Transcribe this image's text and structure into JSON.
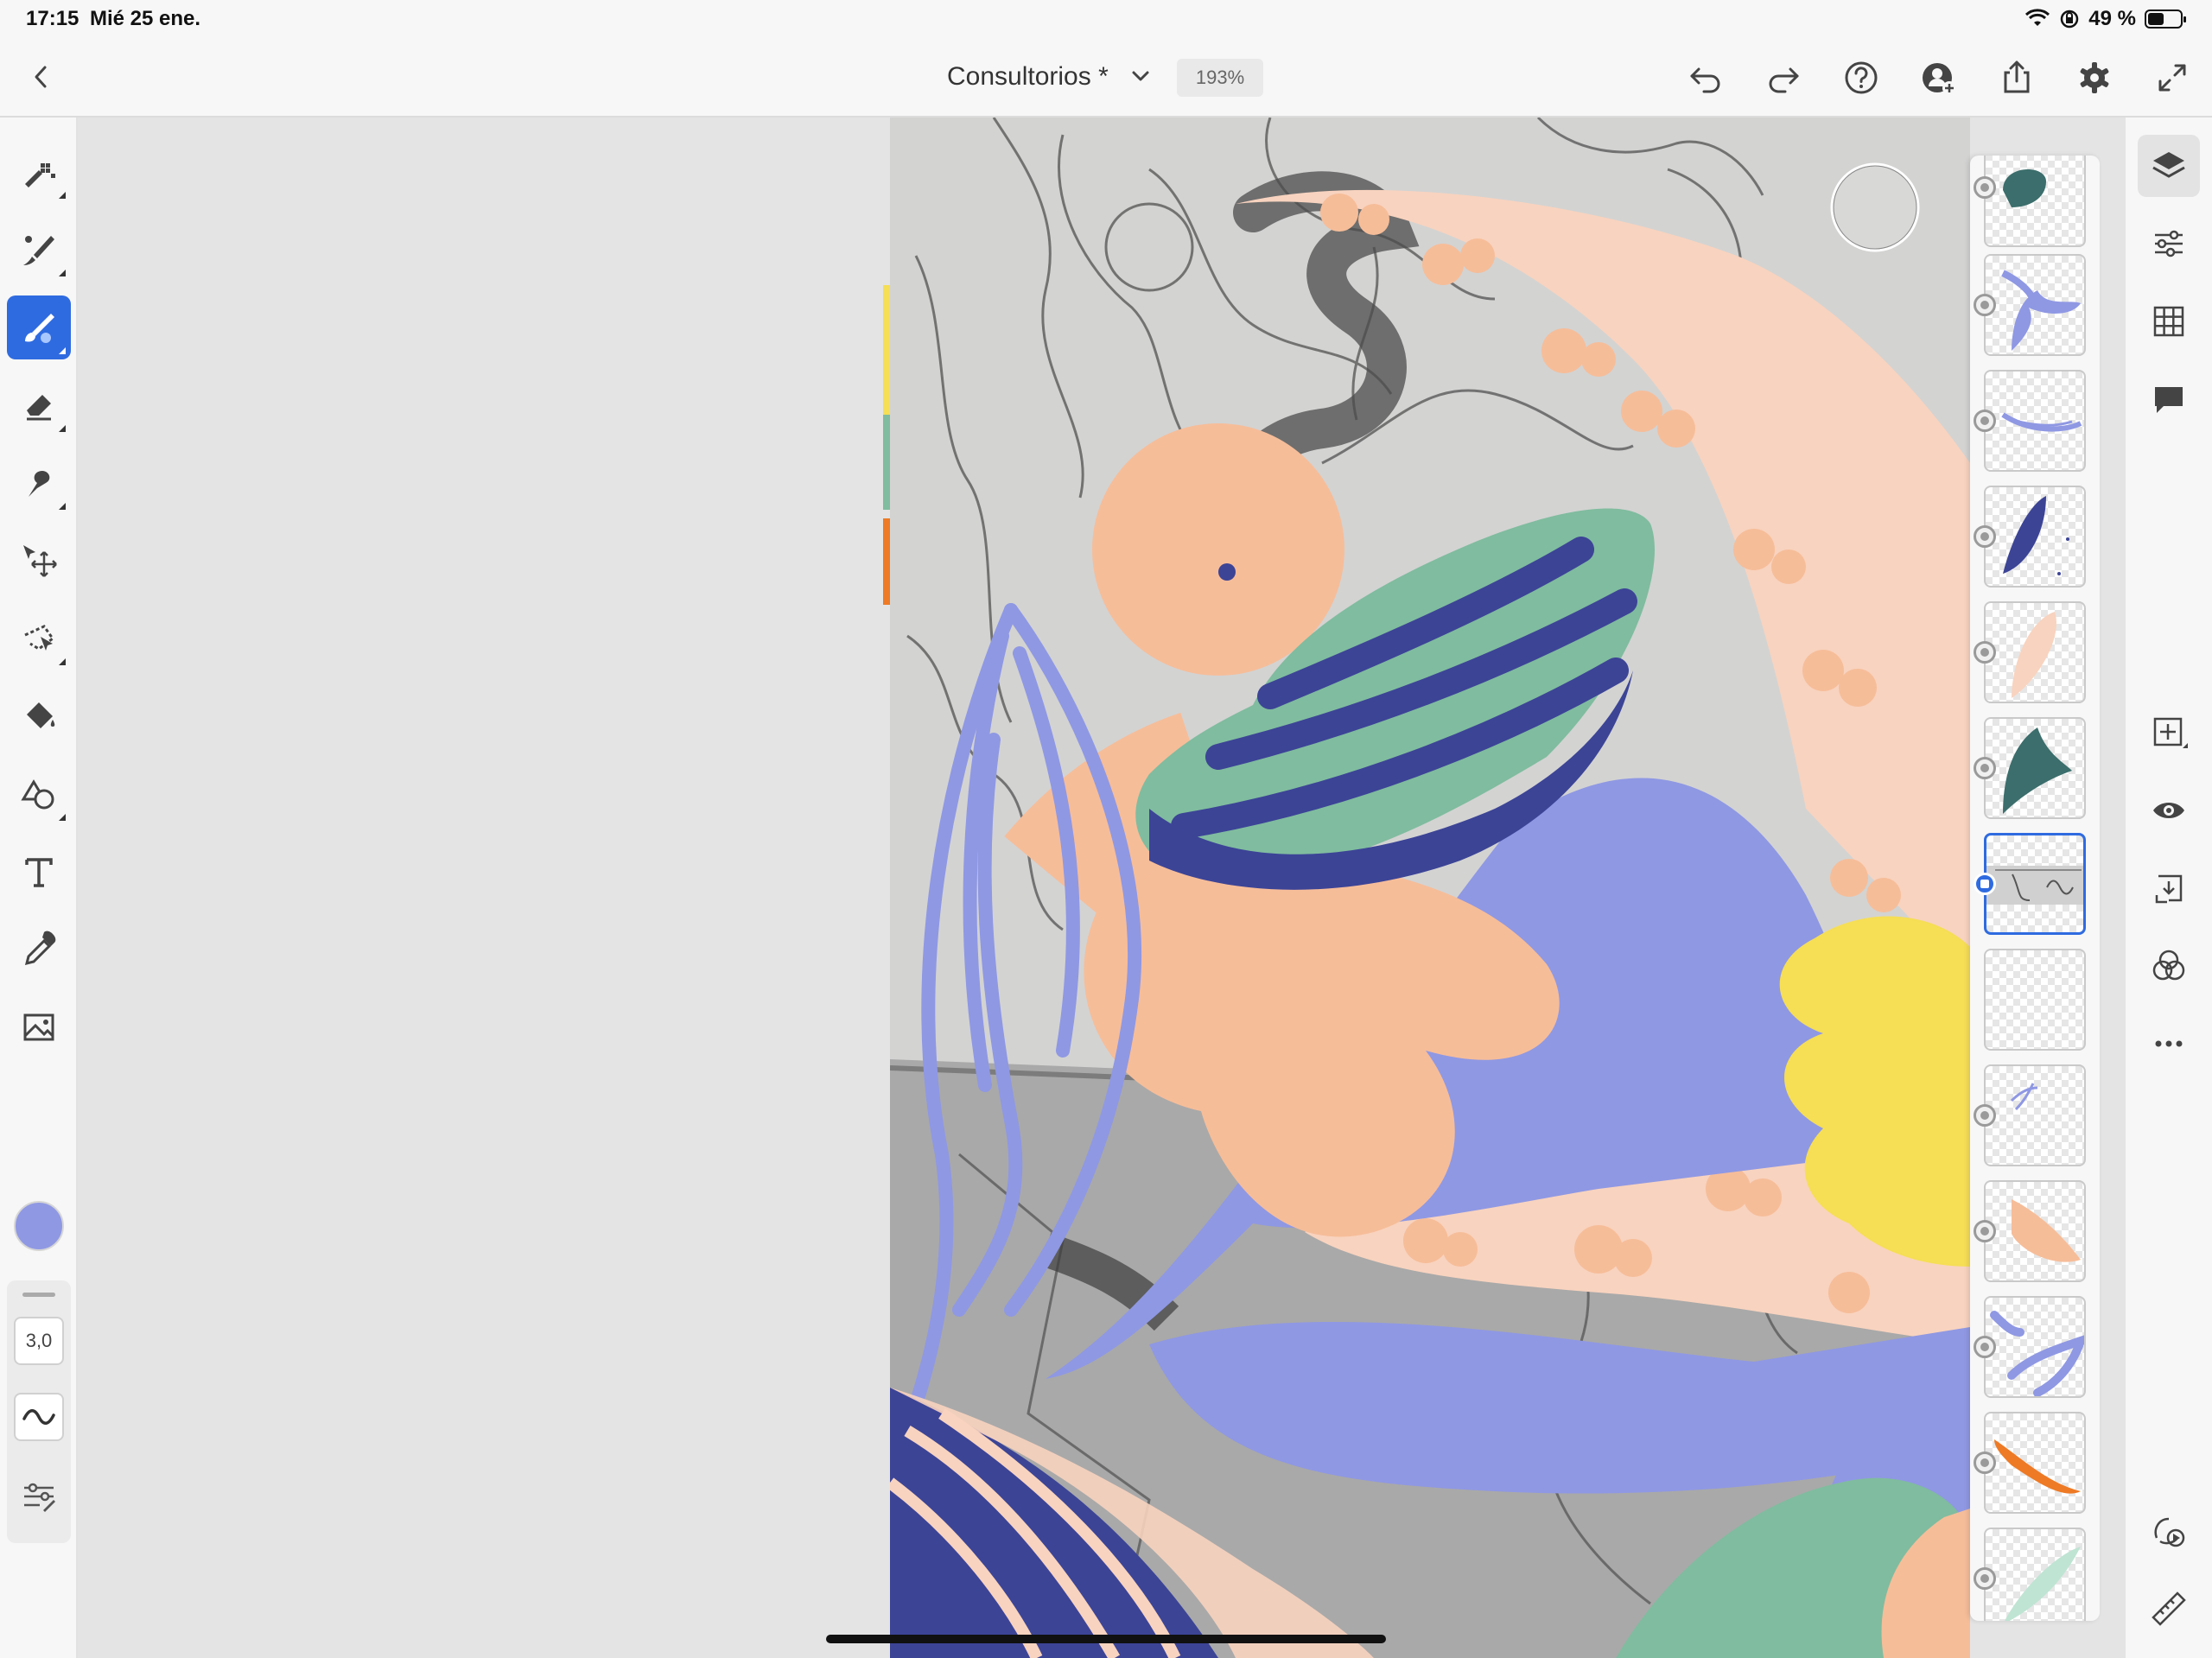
{
  "status_bar": {
    "time": "17:15",
    "date": "Mié 25 ene.",
    "battery": "49 %",
    "battery_level": 0.49
  },
  "header": {
    "document_title": "Consultorios *",
    "zoom_level": "193%"
  },
  "toolbar": {
    "brush_size": "3,0",
    "active_tool": "paint-brush-icon",
    "current_color": "#8f98e3"
  },
  "layers": {
    "count": 13,
    "selected_index": 6
  },
  "colors": {
    "accent": "#2f6be0",
    "peach": "#f6bd99",
    "light_peach": "#f9d5c0",
    "periwinkle": "#8f98e3",
    "navy": "#3c4496",
    "green": "#80bc9f",
    "teal": "#3b6e6c",
    "yellow": "#f6de55",
    "orange": "#ee7a25"
  }
}
